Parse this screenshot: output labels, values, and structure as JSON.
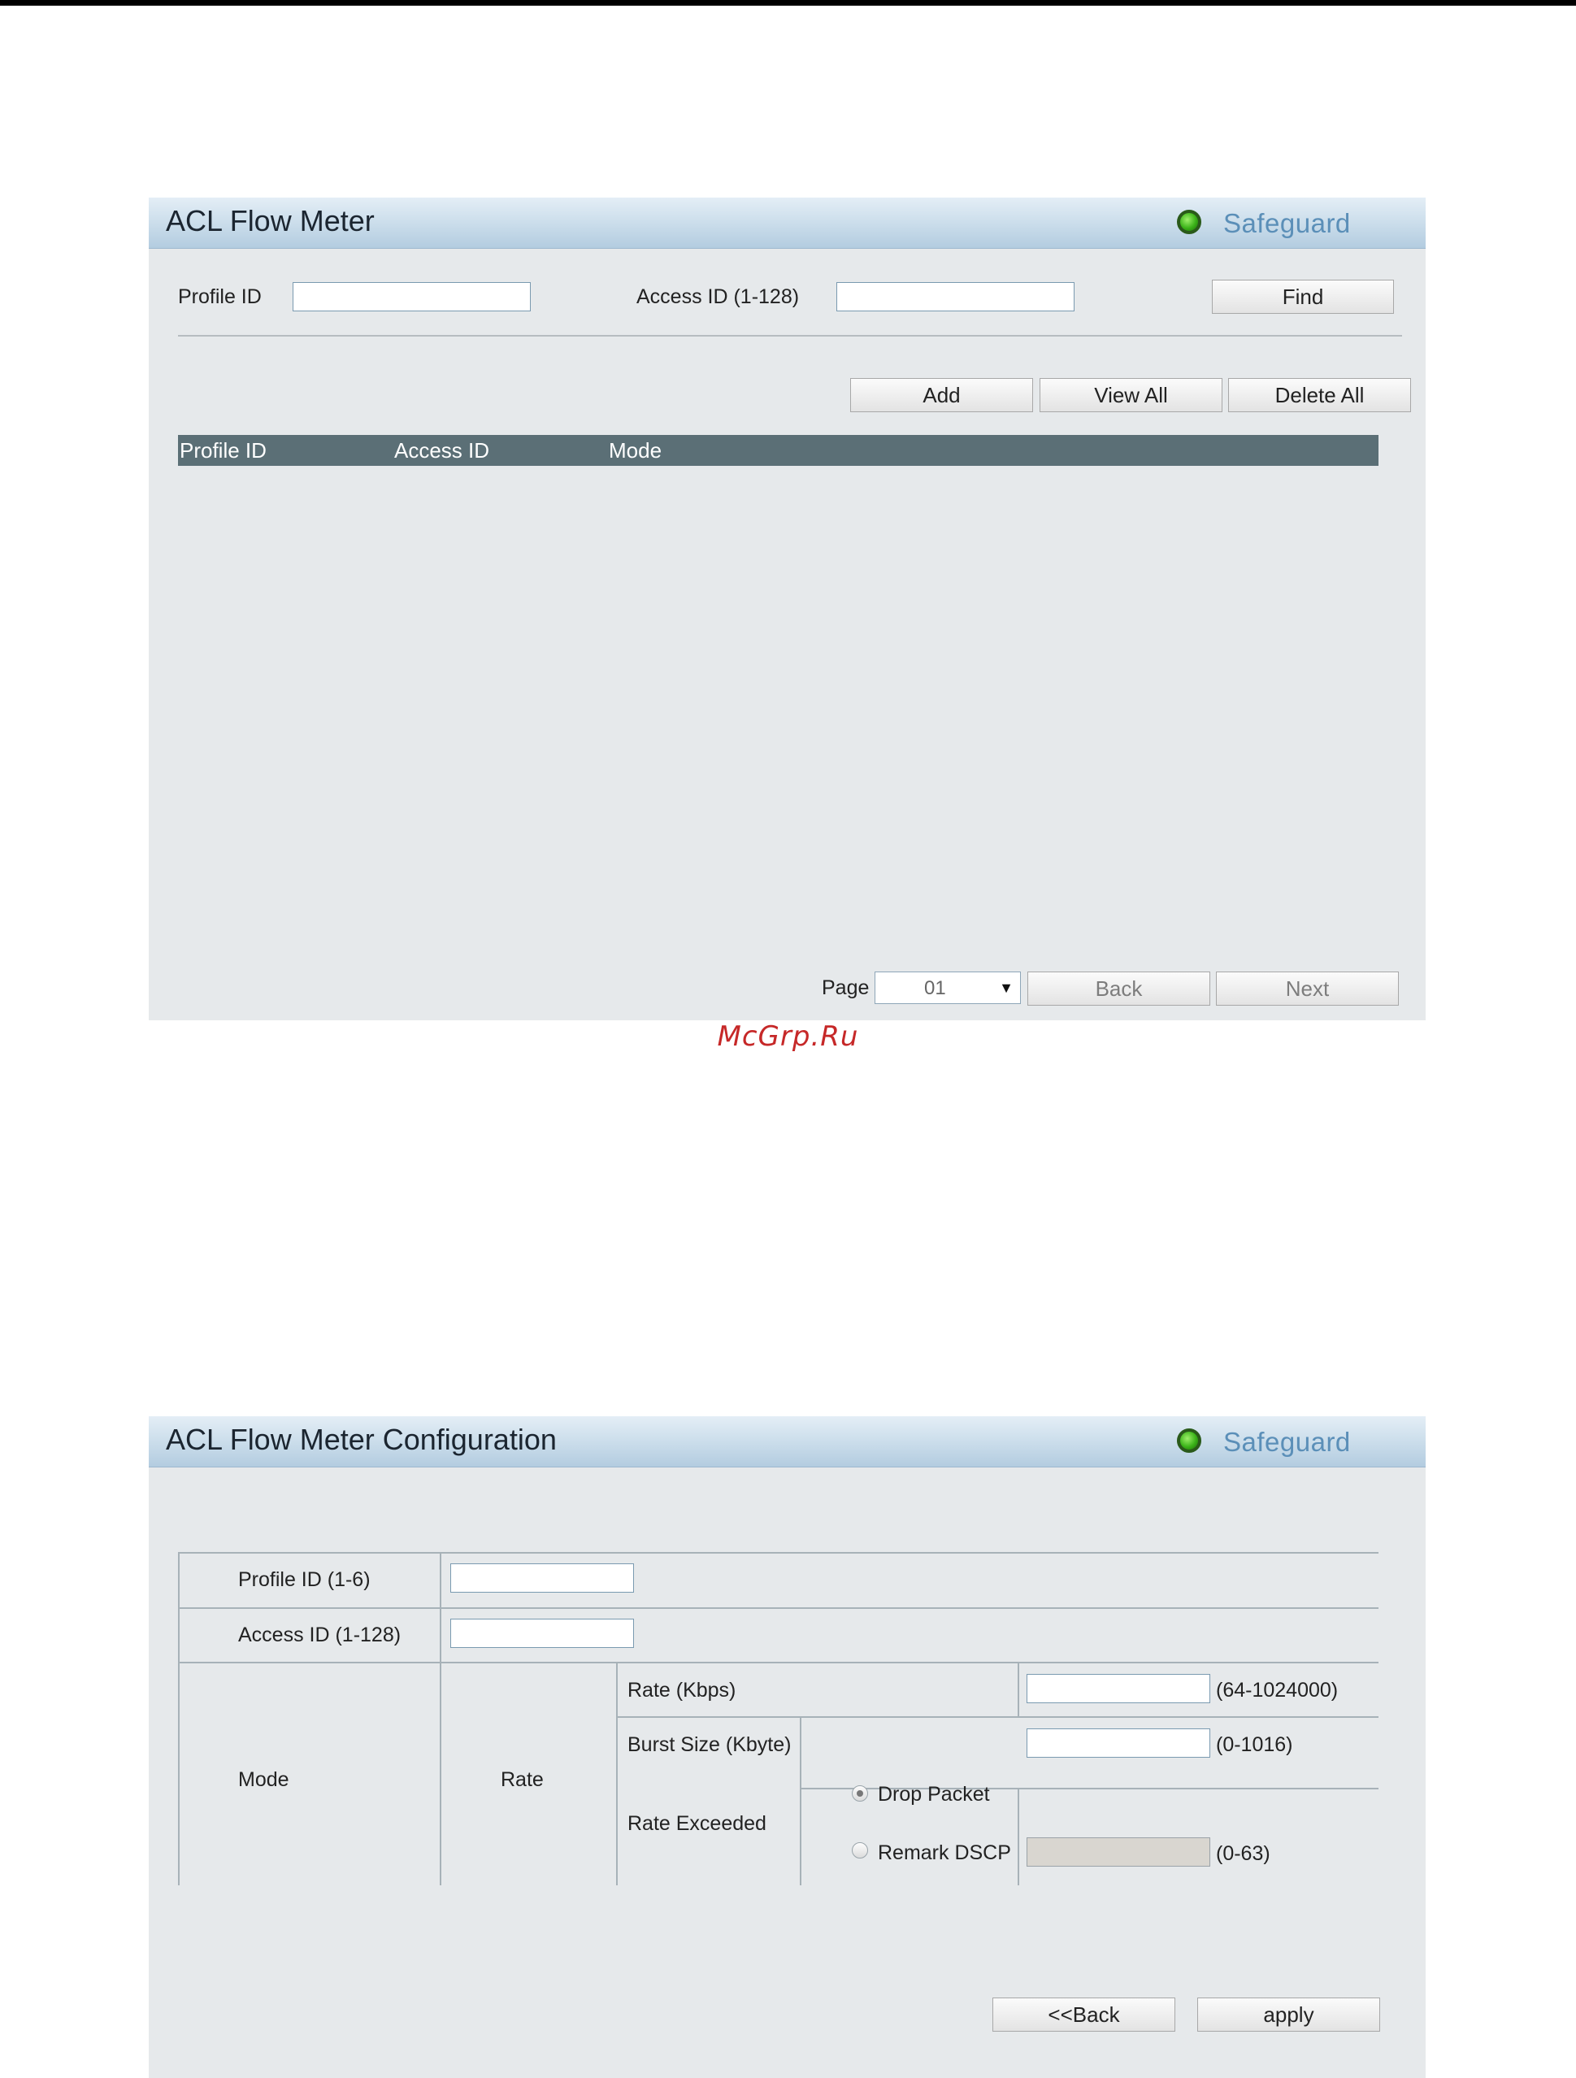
{
  "flow_meter": {
    "title": "ACL Flow Meter",
    "safeguard": "Safeguard",
    "profile_id_label": "Profile ID",
    "profile_id_value": "",
    "access_id_label": "Access ID (1-128)",
    "access_id_value": "",
    "find_label": "Find",
    "add_label": "Add",
    "view_all_label": "View All",
    "delete_all_label": "Delete All",
    "table_headers": [
      "Profile ID",
      "Access ID",
      "Mode"
    ],
    "page_label": "Page",
    "page_value": "01",
    "back_label": "Back",
    "next_label": "Next"
  },
  "watermark": "McGrp.Ru",
  "config": {
    "title": "ACL Flow Meter Configuration",
    "safeguard": "Safeguard",
    "profile_id_label": "Profile ID (1-6)",
    "profile_id_value": "",
    "access_id_label": "Access ID (1-128)",
    "access_id_value": "",
    "mode_label": "Mode",
    "rate_label": "Rate",
    "rate_kbps_label": "Rate (Kbps)",
    "rate_kbps_value": "",
    "rate_kbps_range": "(64-1024000)",
    "burst_label": "Burst Size (Kbyte)",
    "burst_value": "",
    "burst_range": "(0-1016)",
    "rate_exceeded_label": "Rate Exceeded",
    "drop_packet_label": "Drop Packet",
    "remark_dscp_label": "Remark DSCP",
    "remark_dscp_value": "",
    "remark_dscp_range": "(0-63)",
    "back_label": "<<Back",
    "apply_label": "apply"
  },
  "colors": {
    "panel_bg": "#e6e9eb",
    "table_header_bg": "#5b6f76",
    "safeguard_text": "#5b8fb8",
    "watermark": "#c62828"
  },
  "icons": [
    "safeguard-status-icon",
    "dropdown-arrow-icon"
  ]
}
